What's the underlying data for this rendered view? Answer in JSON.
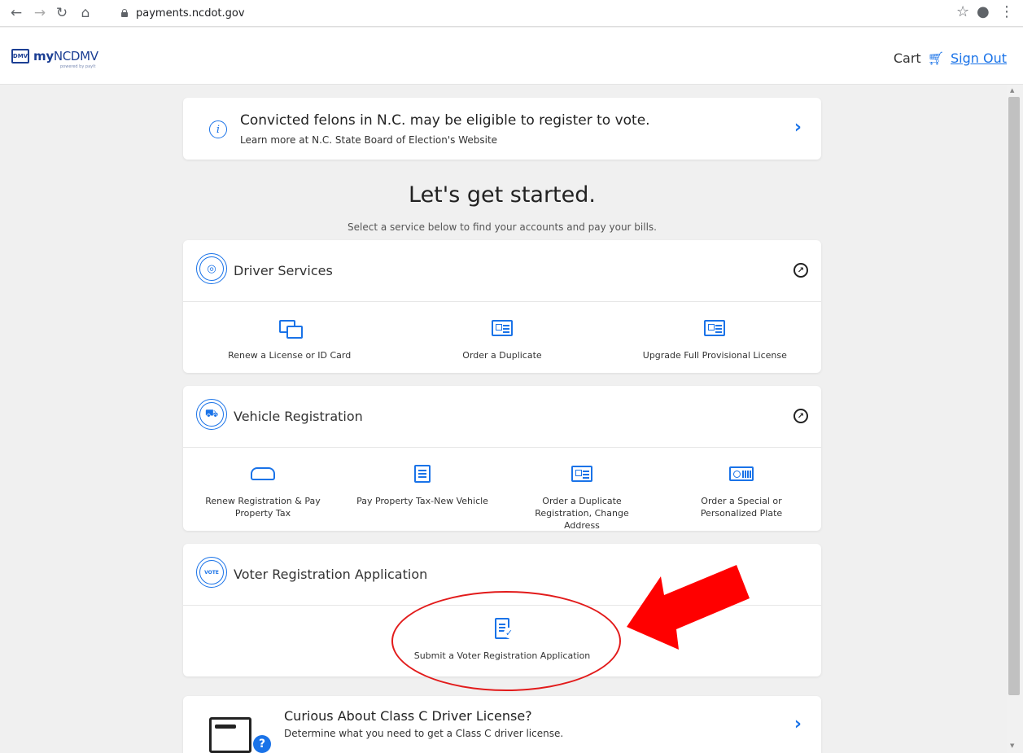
{
  "browser": {
    "url": "payments.ncdot.gov"
  },
  "header": {
    "logo_badge": "DMV",
    "logo_bold": "my",
    "logo_text": "NCDMV",
    "logo_sub": "powered by paylt",
    "cart": "Cart",
    "sign_out": "Sign Out"
  },
  "alert": {
    "title": "Convicted felons in N.C. may be eligible to register to vote.",
    "subtitle": "Learn more at N.C. State Board of Election's Website"
  },
  "intro": {
    "heading": "Let's get started.",
    "subheading": "Select a service below to find your accounts and pay your bills."
  },
  "sections": {
    "driver": {
      "title": "Driver Services",
      "services": [
        {
          "label": "Renew a License or ID Card"
        },
        {
          "label": "Order a Duplicate"
        },
        {
          "label": "Upgrade Full Provisional License"
        }
      ]
    },
    "vehicle": {
      "title": "Vehicle Registration",
      "services": [
        {
          "label": "Renew Registration & Pay Property Tax"
        },
        {
          "label": "Pay Property Tax-New Vehicle"
        },
        {
          "label": "Order a Duplicate Registration, Change Address"
        },
        {
          "label": "Order a Special or Personalized Plate"
        }
      ]
    },
    "voter": {
      "title": "Voter Registration Application",
      "icon_text": "VOTE",
      "services": [
        {
          "label": "Submit a Voter Registration Application"
        }
      ]
    }
  },
  "promo": {
    "title": "Curious About Class C Driver License?",
    "subtitle": "Determine what you need to get a Class C driver license."
  },
  "colors": {
    "accent": "#1a73e8",
    "annotation": "#e21b1b",
    "background": "#f0f0f0"
  }
}
